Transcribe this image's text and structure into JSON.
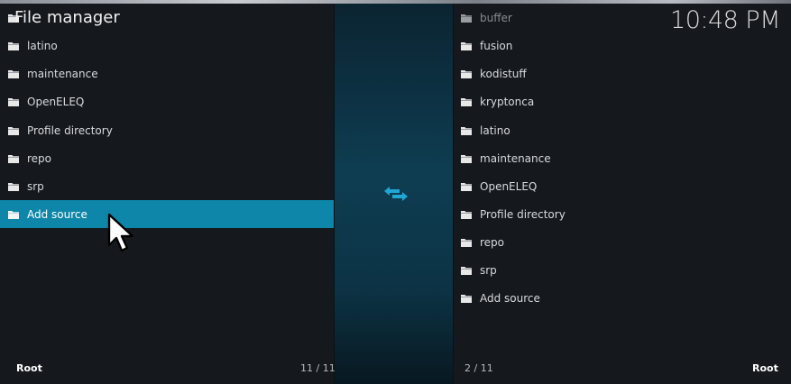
{
  "app": {
    "title": "File manager",
    "clock": "10:48 PM"
  },
  "left": {
    "items": [
      {
        "label": ""
      },
      {
        "label": "latino"
      },
      {
        "label": "maintenance"
      },
      {
        "label": "OpenELEQ"
      },
      {
        "label": "Profile directory"
      },
      {
        "label": "repo"
      },
      {
        "label": "srp"
      },
      {
        "label": "Add source"
      }
    ],
    "selected_index": 7,
    "footer_path": "Root",
    "footer_count": "11 / 11"
  },
  "right": {
    "items": [
      {
        "label": "buffer"
      },
      {
        "label": "fusion"
      },
      {
        "label": "kodistuff"
      },
      {
        "label": "kryptonca"
      },
      {
        "label": "latino"
      },
      {
        "label": "maintenance"
      },
      {
        "label": "OpenELEQ"
      },
      {
        "label": "Profile directory"
      },
      {
        "label": "repo"
      },
      {
        "label": "srp"
      },
      {
        "label": "Add source"
      }
    ],
    "footer_path": "Root",
    "footer_count": "2 / 11"
  },
  "icons": {
    "folder": "folder-icon",
    "swap": "swap-arrows-icon",
    "cursor": "mouse-pointer-icon"
  },
  "colors": {
    "accent": "#0e86a9",
    "swap_icon": "#1fa6d4",
    "background": "#15191e"
  }
}
